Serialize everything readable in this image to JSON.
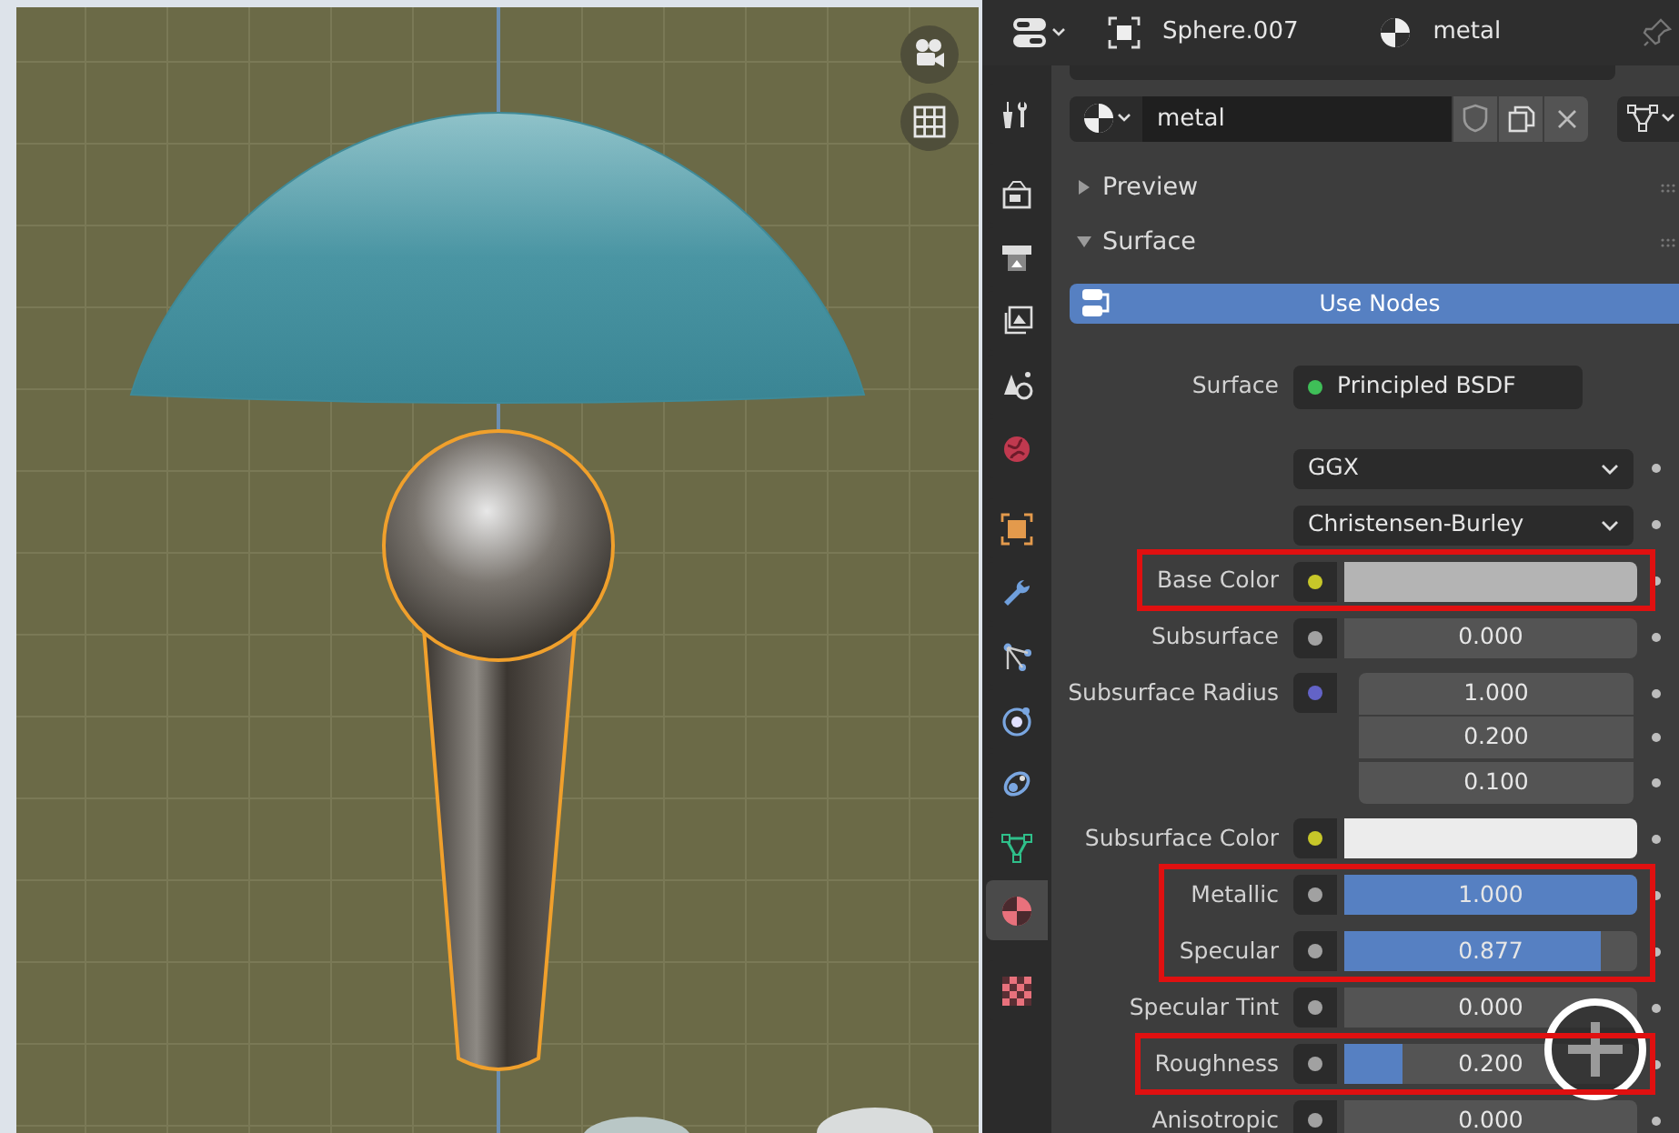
{
  "header": {
    "object": "Sphere.007",
    "material": "metal"
  },
  "tab_groups": [
    [
      {
        "selected": false
      }
    ],
    [
      {
        "selected": false
      },
      {
        "selected": false
      },
      {
        "selected": false
      },
      {
        "selected": false
      },
      {
        "selected": false
      }
    ],
    [
      {
        "selected": false
      },
      {
        "selected": false
      },
      {
        "selected": false
      },
      {
        "selected": false
      },
      {
        "selected": false
      },
      {
        "selected": false
      },
      {
        "selected": true
      }
    ],
    [
      {
        "selected": false
      }
    ]
  ],
  "material_slot": {
    "name": "metal"
  },
  "panels": [
    {
      "title": "Preview",
      "expanded": false
    },
    {
      "title": "Surface",
      "expanded": true
    }
  ],
  "use_nodes": {
    "label": "Use Nodes",
    "on": true
  },
  "properties": [
    {
      "kind": "link",
      "label": "Surface",
      "socket": {
        "color": "#3fbf58"
      },
      "value": "Principled BSDF",
      "highlighted": false
    },
    {
      "kind": "enum",
      "value": "GGX",
      "highlighted": false
    },
    {
      "kind": "enum",
      "value": "Christensen-Burley",
      "highlighted": false
    },
    {
      "kind": "color",
      "label": "Base Color",
      "socket": {
        "color": "#c7c729"
      },
      "swatch": {
        "color": "#b4b4b4"
      },
      "highlighted": true
    },
    {
      "kind": "slider",
      "label": "Subsurface",
      "socket": {
        "color": "#a1a1a1"
      },
      "value": "0.000",
      "level": 0,
      "highlighted": false
    },
    {
      "kind": "vector",
      "label": "Subsurface Radius",
      "socket": {
        "color": "#6363c7"
      },
      "values": [
        "1.000",
        "0.200",
        "0.100"
      ],
      "highlighted": false
    },
    {
      "kind": "color",
      "label": "Subsurface Color",
      "socket": {
        "color": "#c7c729"
      },
      "swatch": {
        "color": "#ececec"
      },
      "highlighted": false
    },
    {
      "kind": "slider",
      "label": "Metallic",
      "socket": {
        "color": "#a1a1a1"
      },
      "value": "1.000",
      "level": 1,
      "highlighted": true
    },
    {
      "kind": "slider",
      "label": "Specular",
      "socket": {
        "color": "#a1a1a1"
      },
      "value": "0.877",
      "level": 0.877,
      "highlighted": true
    },
    {
      "kind": "slider",
      "label": "Specular Tint",
      "socket": {
        "color": "#a1a1a1"
      },
      "value": "0.000",
      "level": 0,
      "highlighted": false
    },
    {
      "kind": "slider",
      "label": "Roughness",
      "socket": {
        "color": "#a1a1a1"
      },
      "value": "0.200",
      "level": 0.2,
      "highlighted": true
    },
    {
      "kind": "slider",
      "label": "Anisotropic",
      "socket": {
        "color": "#a1a1a1"
      },
      "value": "0.000",
      "level": 0,
      "highlighted": false
    }
  ]
}
